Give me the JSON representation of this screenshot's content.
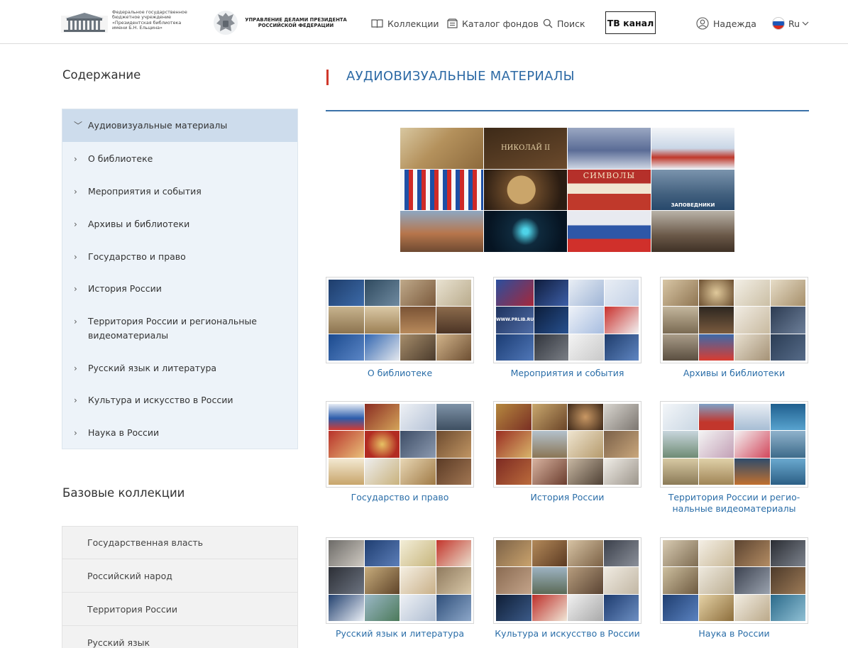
{
  "header": {
    "logo_lines": [
      "Федеральное государственное",
      "бюджетное учреждение",
      "«Президентская библиотека",
      "имени Б.Н. Ельцина»"
    ],
    "admin_lines": [
      "УПРАВЛЕНИЕ ДЕЛАМИ ПРЕЗИДЕНТА",
      "РОССИЙСКОЙ ФЕДЕРАЦИИ"
    ],
    "nav": {
      "collections": "Коллекции",
      "catalog": "Каталог фондов",
      "search": "Поиск",
      "tv": "ТВ канал",
      "user": "Надежда",
      "lang": "Ru"
    },
    "icons": {
      "collections": "book-icon",
      "catalog": "catalog-icon",
      "search": "search-icon",
      "user": "user-icon",
      "lang": "flag-ru-icon"
    }
  },
  "sidebar": {
    "title": "Содержание",
    "items": [
      {
        "label": "Аудиовизуальные материалы",
        "expanded": true,
        "active": true
      },
      {
        "label": "О библиотеке"
      },
      {
        "label": "Мероприятия и события"
      },
      {
        "label": "Архивы и библиотеки"
      },
      {
        "label": "Государство и право"
      },
      {
        "label": "История России"
      },
      {
        "label": "Территория России и региональные видеоматериалы"
      },
      {
        "label": "Русский язык и литература"
      },
      {
        "label": "Культура и искусство в России"
      },
      {
        "label": "Наука в России"
      }
    ],
    "base_title": "Базовые коллекции",
    "base_items": [
      "Государственная власть",
      "Российский народ",
      "Территория России",
      "Русский язык"
    ]
  },
  "main": {
    "title": "АУДИОВИЗУАЛЬНЫЕ МАТЕРИАЛЫ",
    "banner_labels": {
      "nikolay": "НИКОЛАЙ II",
      "symbols": "СИМВОЛЫ",
      "reserves": "ЗАПОВЕДНИКИ"
    },
    "cards": [
      {
        "caption": "О библиотеке"
      },
      {
        "caption": "Мероприятия и события"
      },
      {
        "caption": "Архивы и библиотеки"
      },
      {
        "caption": "Государство и право"
      },
      {
        "caption": "История России"
      },
      {
        "caption": "Территория России и регио-нальные видеоматериалы"
      },
      {
        "caption": "Русский язык и литература"
      },
      {
        "caption": "Культура и искусство в России"
      },
      {
        "caption": "Наука в России"
      }
    ],
    "card_labels": {
      "site": "WWW.PRLIB.RU"
    }
  },
  "colors": {
    "accent": "#2d6aa5",
    "title_marker": "#d0382b",
    "menu_bg": "#edf3f9",
    "menu_active": "#cddcec"
  }
}
